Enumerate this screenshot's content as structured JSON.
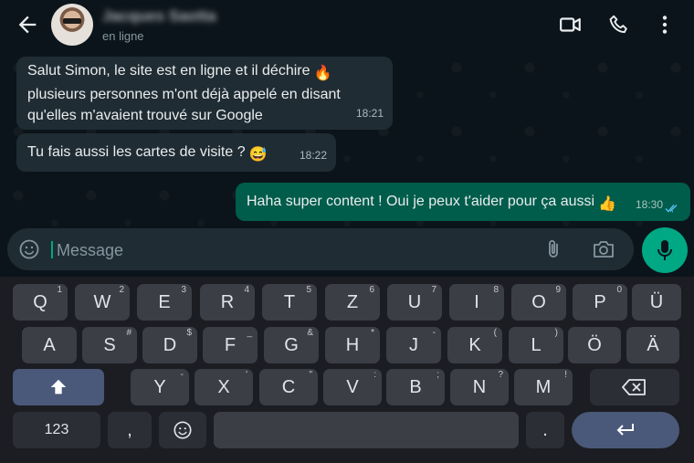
{
  "header": {
    "contact_name": "Jacques Saotta",
    "status": "en ligne"
  },
  "messages": [
    {
      "direction": "in",
      "text": "Salut Simon, le site est en ligne et il déchire",
      "emoji": "🔥",
      "text2": "plusieurs personnes m'ont déjà appelé en disant qu'elles m'avaient trouvé sur Google",
      "time": "18:21"
    },
    {
      "direction": "in",
      "text": "Tu fais aussi les cartes de visite ?",
      "emoji": "😅",
      "time": "18:22"
    },
    {
      "direction": "out",
      "text": "Haha super content ! Oui je peux t'aider pour ça aussi",
      "emoji": "👍",
      "time": "18:30",
      "read": true
    }
  ],
  "input": {
    "placeholder": "Message"
  },
  "keyboard": {
    "row1": [
      {
        "label": "Q",
        "hint": "1"
      },
      {
        "label": "W",
        "hint": "2"
      },
      {
        "label": "E",
        "hint": "3"
      },
      {
        "label": "R",
        "hint": "4"
      },
      {
        "label": "T",
        "hint": "5"
      },
      {
        "label": "Z",
        "hint": "6"
      },
      {
        "label": "U",
        "hint": "7"
      },
      {
        "label": "I",
        "hint": "8"
      },
      {
        "label": "O",
        "hint": "9"
      },
      {
        "label": "P",
        "hint": "0"
      },
      {
        "label": "Ü",
        "hint": ""
      }
    ],
    "row2": [
      {
        "label": "A",
        "hint": ""
      },
      {
        "label": "S",
        "hint": "#"
      },
      {
        "label": "D",
        "hint": "$"
      },
      {
        "label": "F",
        "hint": "_"
      },
      {
        "label": "G",
        "hint": "&"
      },
      {
        "label": "H",
        "hint": "*"
      },
      {
        "label": "J",
        "hint": "-"
      },
      {
        "label": "K",
        "hint": "("
      },
      {
        "label": "L",
        "hint": ")"
      },
      {
        "label": "Ö",
        "hint": ""
      },
      {
        "label": "Ä",
        "hint": ""
      }
    ],
    "row3": [
      {
        "label": "Y",
        "hint": "-"
      },
      {
        "label": "X",
        "hint": "'"
      },
      {
        "label": "C",
        "hint": "\""
      },
      {
        "label": "V",
        "hint": ":"
      },
      {
        "label": "B",
        "hint": ";"
      },
      {
        "label": "N",
        "hint": "?"
      },
      {
        "label": "M",
        "hint": "!"
      }
    ],
    "numbers_label": "123",
    "comma_label": ",",
    "period_label": "."
  },
  "colors": {
    "accent": "#00a884",
    "outgoing": "#005c4b",
    "incoming": "#202c33",
    "read_ticks": "#53bdeb"
  }
}
